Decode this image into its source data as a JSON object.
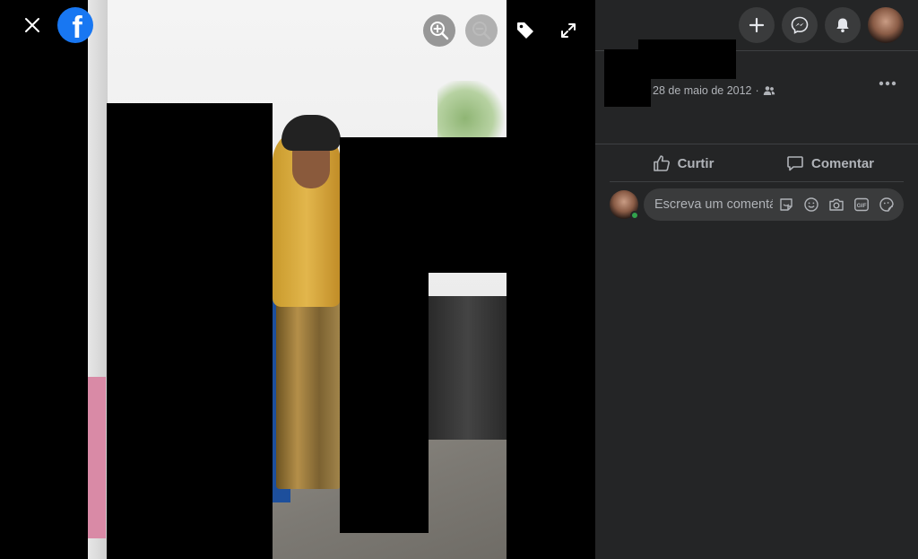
{
  "viewer": {
    "logo_letter": "f",
    "icons": [
      "close-icon",
      "facebook-logo-icon",
      "zoom-in-icon",
      "zoom-out-icon",
      "tag-icon",
      "fullscreen-icon"
    ]
  },
  "topbar": {
    "icons": [
      "plus-icon",
      "messenger-icon",
      "notifications-bell-icon",
      "profile-avatar"
    ]
  },
  "post": {
    "date": "28 de maio de 2012",
    "audience_icon": "friends-icon",
    "more_icon": "more-options-icon"
  },
  "actions": {
    "like_label": "Curtir",
    "comment_label": "Comentar"
  },
  "comment_box": {
    "placeholder": "Escreva um comentário...",
    "icons": [
      "sticker-icon",
      "emoji-icon",
      "camera-icon",
      "gif-icon",
      "avatar-sticker-icon"
    ]
  },
  "colors": {
    "panel_bg": "#242526",
    "button_bg": "#3a3b3c",
    "text_primary": "#e4e6eb",
    "text_secondary": "#b0b3b8",
    "brand": "#1877f2",
    "online": "#31a24c"
  }
}
